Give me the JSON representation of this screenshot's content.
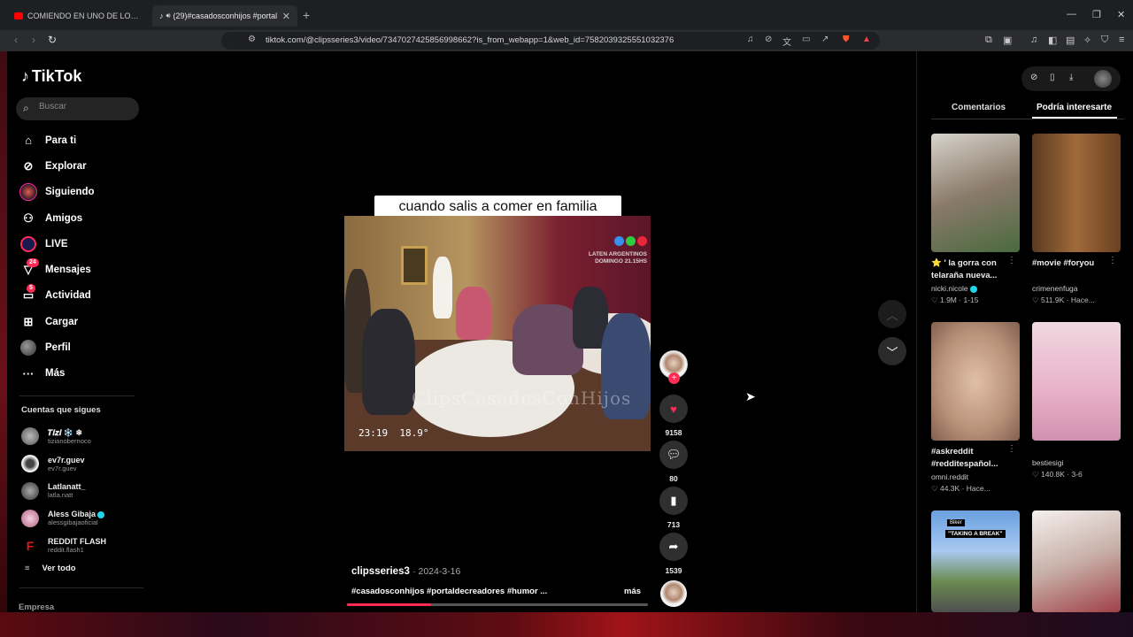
{
  "browser": {
    "tabs": [
      {
        "title": "COMIENDO EN UNO DE LOS MEJORES",
        "favicon_color": "#ff0000"
      },
      {
        "title": "(29)#casadosconhijos #portal",
        "favicon_color": "#ffffff"
      }
    ],
    "url": "tiktok.com/@clipsseries3/video/7347027425856998662?is_from_webapp=1&web_id=7582039325551032376"
  },
  "tiktok": {
    "logo": "TikTok",
    "search_placeholder": "Buscar",
    "nav": [
      {
        "label": "Para ti",
        "icon": "home-icon"
      },
      {
        "label": "Explorar",
        "icon": "compass-icon"
      },
      {
        "label": "Siguiendo",
        "icon": "following-avatar"
      },
      {
        "label": "Amigos",
        "icon": "friends-icon"
      },
      {
        "label": "LIVE",
        "icon": "live-icon"
      },
      {
        "label": "Mensajes",
        "icon": "send-icon",
        "badge": "24"
      },
      {
        "label": "Actividad",
        "icon": "activity-icon",
        "badge": "5"
      },
      {
        "label": "Cargar",
        "icon": "upload-icon"
      },
      {
        "label": "Perfil",
        "icon": "profile-avatar"
      },
      {
        "label": "Más",
        "icon": "more-icon"
      }
    ],
    "following_header": "Cuentas que sigues",
    "following": [
      {
        "name": "𝑻𝒊𝒛𝒊 ❄️ ❄",
        "handle": "tizianobernoco",
        "avatar_color": "#888888",
        "verified": false
      },
      {
        "name": "ev7r.guev",
        "handle": "ev7r.guev",
        "avatar_color": "#cccccc",
        "verified": false
      },
      {
        "name": "Latlanatt_",
        "handle": "latla.natt",
        "avatar_color": "#777777",
        "verified": false
      },
      {
        "name": "Aless Gibaja",
        "handle": "alessgibajaoficial",
        "avatar_color": "#d9a0c0",
        "verified": true
      },
      {
        "name": "REDDIT FLASH",
        "handle": "reddit.flash1",
        "avatar_color": "#e01818",
        "verified": false
      }
    ],
    "see_all": "Ver todo",
    "empresa": "Empresa"
  },
  "video": {
    "caption_overlay": "cuando salis a comer en familia",
    "watermark": "ClipsCasadosConHijos",
    "stamp": "LATEN ARGENTINOS\nDOMINGO 21.15HS",
    "timestamp_overlay": "23:19  18.9°",
    "author": "clipsseries3",
    "date": "2024-3-16",
    "description": "#casadosconhijos #portaldecreadores #humor ...",
    "more": "más",
    "progress": 0.28,
    "actions": {
      "likes": "9158",
      "comments": "80",
      "saves": "713",
      "shares": "1539"
    }
  },
  "right_panel": {
    "tabs": [
      "Comentarios",
      "Podría interesarte"
    ],
    "active_tab": "Podría interesarte",
    "cards": [
      {
        "title": "⭐ ' la gorra con telaraña nueva...",
        "author": "nicki.nicole",
        "verified": true,
        "likes": "1.9M",
        "meta": "1-15"
      },
      {
        "title": "#movie #foryou",
        "author": "crimenenfuga",
        "verified": false,
        "likes": "511.9K",
        "meta": "Hace..."
      },
      {
        "title": "#askreddit #redditespañol...",
        "author": "omni.reddit",
        "verified": false,
        "likes": "44.3K",
        "meta": "Hace..."
      },
      {
        "title": "",
        "author": "bestiesigi",
        "verified": false,
        "likes": "140.8K",
        "meta": "3-6"
      },
      {
        "title": "",
        "author": "",
        "verified": false,
        "likes": "",
        "meta": "",
        "overlay_tag": "Biker",
        "overlay_text": "\"TAKING A BREAK\""
      },
      {
        "title": "",
        "author": "",
        "verified": false,
        "likes": "",
        "meta": ""
      }
    ]
  },
  "colors": {
    "accent": "#fe2c55",
    "background": "#000000"
  }
}
